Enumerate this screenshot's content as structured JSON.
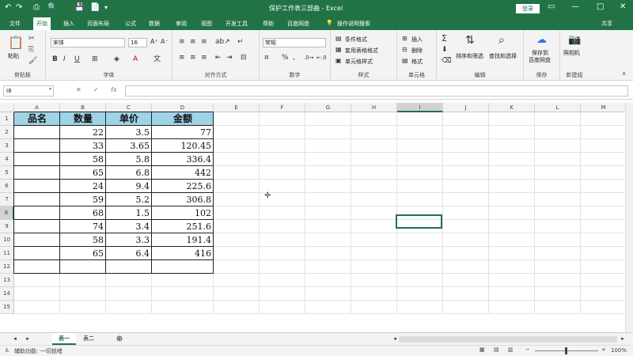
{
  "titlebar": {
    "title": "保护工作表三部曲 - Excel",
    "login": "登录",
    "min": "—",
    "max": "□",
    "close": "✕",
    "quick": [
      "↶",
      "↷",
      "⎙",
      "🔍",
      "💾",
      "📄",
      "▾"
    ]
  },
  "tabs": [
    "文件",
    "开始",
    "插入",
    "页面布局",
    "公式",
    "数据",
    "审阅",
    "视图",
    "开发工具",
    "帮助",
    "百度网盘",
    "操作说明搜索"
  ],
  "share": "共享",
  "ribbon": {
    "clipboard": {
      "paste": "粘贴",
      "label": "剪贴板"
    },
    "font": {
      "name": "宋体",
      "size": "16",
      "bold": "B",
      "italic": "I",
      "underline": "U",
      "grow": "A⁺",
      "shrink": "A⁻",
      "label": "字体"
    },
    "alignment": {
      "label": "对齐方式"
    },
    "number": {
      "format": "常规",
      "percent": "%",
      "comma": ",",
      "label": "数字"
    },
    "styles": {
      "conditional": "条件格式",
      "table": "套用表格格式",
      "cell": "单元格样式",
      "label": "样式"
    },
    "cells": {
      "insert": "插入",
      "delete": "删除",
      "format": "格式",
      "label": "单元格"
    },
    "editing": {
      "sum": "Σ",
      "sort": "排序和筛选",
      "find": "查找和选择",
      "label": "编辑"
    },
    "save": {
      "btn1": "保存到",
      "btn2": "百度网盘",
      "label": "保存"
    },
    "camera": {
      "btn": "照相机",
      "label": "新建组"
    }
  },
  "formula": {
    "namebox": "I8",
    "cancel": "✕",
    "enter": "✓",
    "fx": "fx",
    "value": ""
  },
  "columns": [
    "A",
    "B",
    "C",
    "D",
    "E",
    "F",
    "G",
    "H",
    "I",
    "J",
    "K",
    "L",
    "M"
  ],
  "rows": [
    "1",
    "2",
    "3",
    "4",
    "5",
    "6",
    "7",
    "8",
    "9",
    "10",
    "11",
    "12",
    "13",
    "14",
    "15"
  ],
  "table": {
    "headers": [
      "品名",
      "数量",
      "单价",
      "金额"
    ],
    "rows": [
      [
        "",
        "22",
        "3.5",
        "77"
      ],
      [
        "",
        "33",
        "3.65",
        "120.45"
      ],
      [
        "",
        "58",
        "5.8",
        "336.4"
      ],
      [
        "",
        "65",
        "6.8",
        "442"
      ],
      [
        "",
        "24",
        "9.4",
        "225.6"
      ],
      [
        "",
        "59",
        "5.2",
        "306.8"
      ],
      [
        "",
        "68",
        "1.5",
        "102"
      ],
      [
        "",
        "74",
        "3.4",
        "251.6"
      ],
      [
        "",
        "58",
        "3.3",
        "191.4"
      ],
      [
        "",
        "65",
        "6.4",
        "416"
      ],
      [
        "",
        "",
        "",
        ""
      ]
    ]
  },
  "sheets": [
    "表一",
    "表二"
  ],
  "add_sheet": "⊕",
  "status": {
    "left": "辅助功能: 一切就绪",
    "zoom": "100%"
  },
  "colors": {
    "excel_green": "#217346",
    "header_fill": "#9fd3e6"
  }
}
